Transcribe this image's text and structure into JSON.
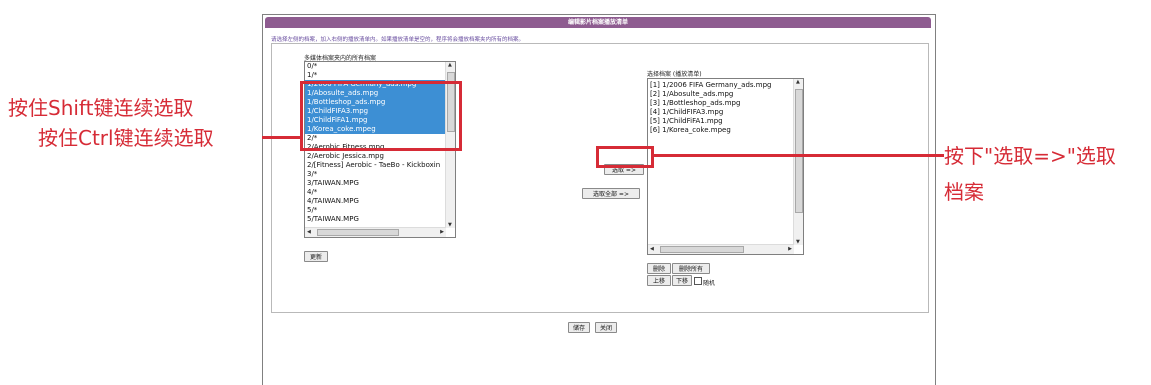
{
  "window": {
    "title": "编辑影片档案播放清单"
  },
  "instruction": "请选择左侧的档案，加入右侧的播放清单内。如果播放清单是空的，程序将会播放档案夹内所有的档案。",
  "left_list": {
    "label": "多媒体档案夹内的所有档案",
    "items": [
      {
        "text": "0/*",
        "selected": false
      },
      {
        "text": "1/*",
        "selected": false
      },
      {
        "text": "1/2006 FIFA Germany_ads.mpg",
        "selected": true
      },
      {
        "text": "1/Abosulte_ads.mpg",
        "selected": true
      },
      {
        "text": "1/Bottleshop_ads.mpg",
        "selected": true
      },
      {
        "text": "1/ChildFIFA3.mpg",
        "selected": true
      },
      {
        "text": "1/ChildFiFA1.mpg",
        "selected": true
      },
      {
        "text": "1/Korea_coke.mpeg",
        "selected": true
      },
      {
        "text": "2/*",
        "selected": false
      },
      {
        "text": "2/Aerobic Fitness.mpg",
        "selected": false
      },
      {
        "text": "2/Aerobic Jessica.mpg",
        "selected": false
      },
      {
        "text": "2/[Fitness] Aerobic - TaeBo - Kickboxin",
        "selected": false
      },
      {
        "text": "3/*",
        "selected": false
      },
      {
        "text": "3/TAIWAN.MPG",
        "selected": false
      },
      {
        "text": "4/*",
        "selected": false
      },
      {
        "text": "4/TAIWAN.MPG",
        "selected": false
      },
      {
        "text": "5/*",
        "selected": false
      },
      {
        "text": "5/TAIWAN.MPG",
        "selected": false
      }
    ],
    "refresh_label": "更新"
  },
  "right_list": {
    "label": "选择档案 (播放清单)",
    "items": [
      "[1] 1/2006 FIFA Germany_ads.mpg",
      "[2] 1/Abosulte_ads.mpg",
      "[3] 1/Bottleshop_ads.mpg",
      "[4] 1/ChildFIFA3.mpg",
      "[5] 1/ChildFiFA1.mpg",
      "[6] 1/Korea_coke.mpeg"
    ],
    "delete_label": "删除",
    "delete_all_label": "删除所有",
    "up_label": "上移",
    "down_label": "下移",
    "random_label": "随机",
    "random_checked": false
  },
  "middle": {
    "select_label": "选取 =>",
    "select_all_label": "选取全部 =>"
  },
  "footer": {
    "save_label": "储存",
    "close_label": "关闭"
  },
  "annotations": {
    "shift_hint": "按住Shift键连续选取",
    "ctrl_hint": "按住Ctrl键连续选取",
    "select_hint_line1": "按下\"选取=>\"选取",
    "select_hint_line2": "档案",
    "color": "#d62b36"
  },
  "colors": {
    "titlebar": "#8e5c90",
    "selection": "#3d8fd4"
  }
}
